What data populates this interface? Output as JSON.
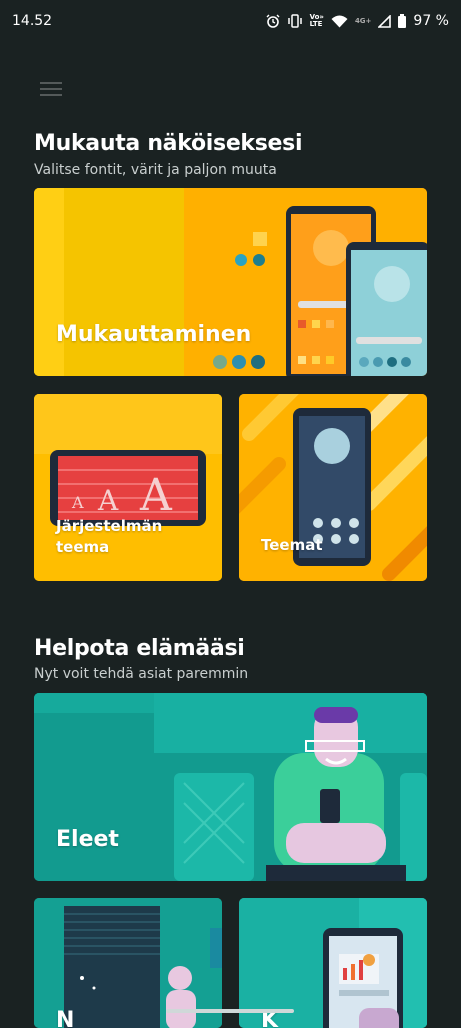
{
  "status": {
    "time": "14.52",
    "net_small": "Vo»\nLTE",
    "net_4g": "4G+",
    "battery": "97 %"
  },
  "section1": {
    "title": "Mukauta näköiseksesi",
    "subtitle": "Valitse fontit, värit ja paljon muuta"
  },
  "cards1": {
    "customize": "Mukauttaminen",
    "system_theme": "Järjestelmän teema",
    "themes": "Teemat"
  },
  "section2": {
    "title": "Helpota elämääsi",
    "subtitle": "Nyt voit tehdä asiat paremmin"
  },
  "cards2": {
    "gestures": "Eleet",
    "card_a_partial": "N",
    "card_b_partial": "K"
  },
  "colors": {
    "bg": "#1a2222",
    "yellow": "#ffb300",
    "teal": "#1aa99a"
  }
}
